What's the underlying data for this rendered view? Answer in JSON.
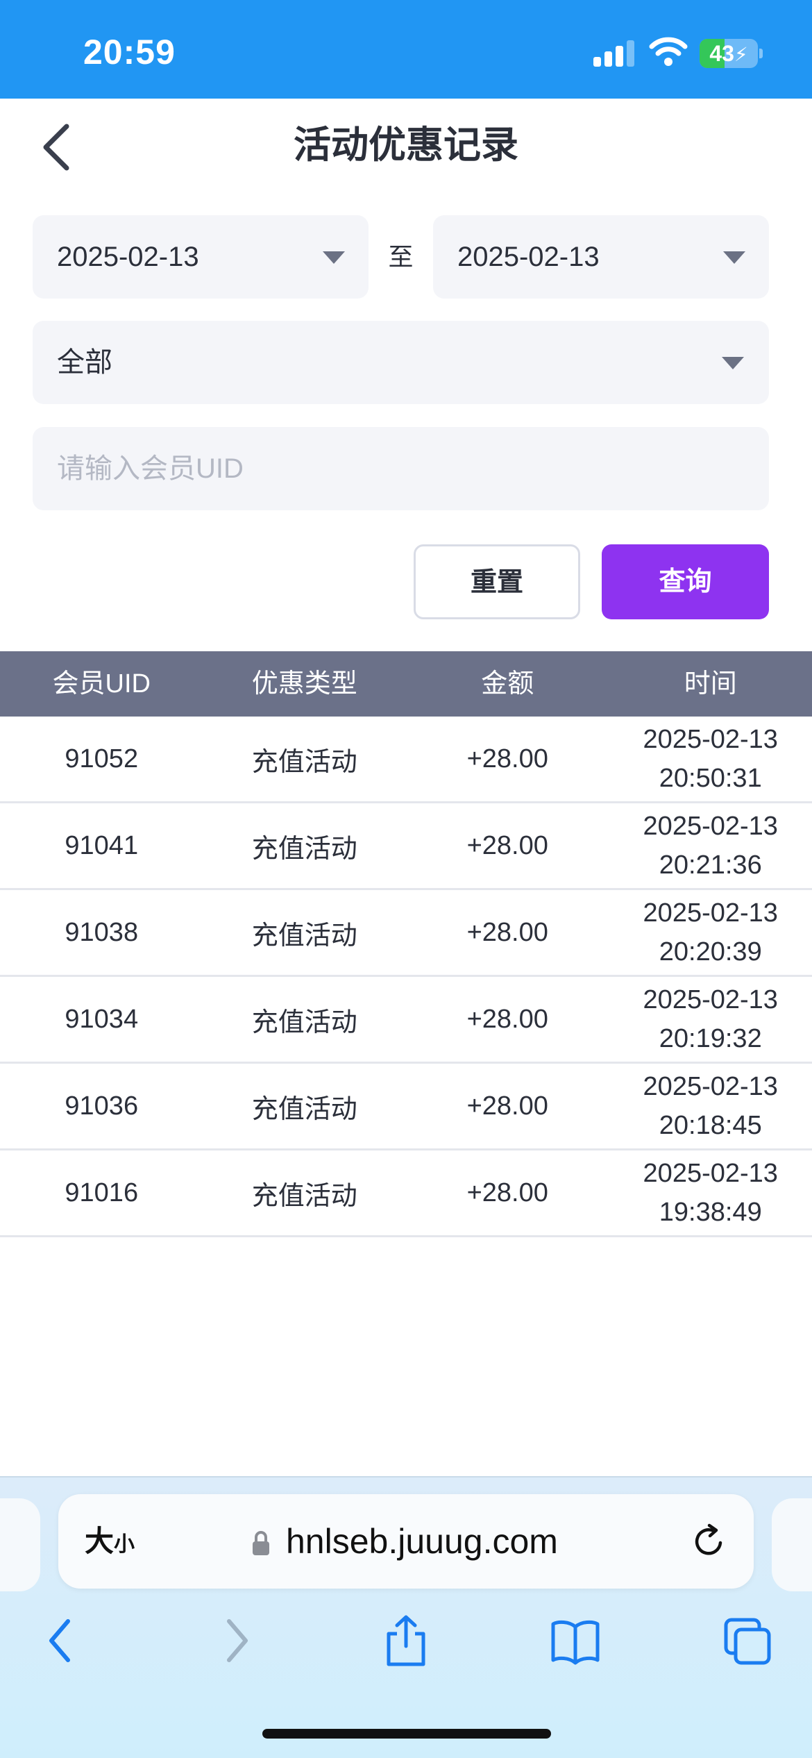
{
  "status_bar": {
    "time": "20:59",
    "battery": "43",
    "battery_level": 0.43
  },
  "header": {
    "title": "活动优惠记录"
  },
  "filters": {
    "start_date": "2025-02-13",
    "separator": "至",
    "end_date": "2025-02-13",
    "type_selected": "全部",
    "uid_placeholder": "请输入会员UID",
    "uid_value": ""
  },
  "buttons": {
    "reset": "重置",
    "query": "查询"
  },
  "table": {
    "columns": [
      "会员UID",
      "优惠类型",
      "金额",
      "时间"
    ],
    "rows": [
      {
        "uid": "91052",
        "type": "充值活动",
        "amount": "+28.00",
        "date": "2025-02-13",
        "time": "20:50:31"
      },
      {
        "uid": "91041",
        "type": "充值活动",
        "amount": "+28.00",
        "date": "2025-02-13",
        "time": "20:21:36"
      },
      {
        "uid": "91038",
        "type": "充值活动",
        "amount": "+28.00",
        "date": "2025-02-13",
        "time": "20:20:39"
      },
      {
        "uid": "91034",
        "type": "充值活动",
        "amount": "+28.00",
        "date": "2025-02-13",
        "time": "20:19:32"
      },
      {
        "uid": "91036",
        "type": "充值活动",
        "amount": "+28.00",
        "date": "2025-02-13",
        "time": "20:18:45"
      },
      {
        "uid": "91016",
        "type": "充值活动",
        "amount": "+28.00",
        "date": "2025-02-13",
        "time": "19:38:49"
      }
    ]
  },
  "browser": {
    "text_size_big": "大",
    "text_size_small": "小",
    "url": "hnlseb.juuug.com"
  },
  "colors": {
    "status_bar": "#2196f3",
    "query_button": "#8e33f0",
    "table_header": "#6b7189",
    "battery": "#34c759"
  }
}
